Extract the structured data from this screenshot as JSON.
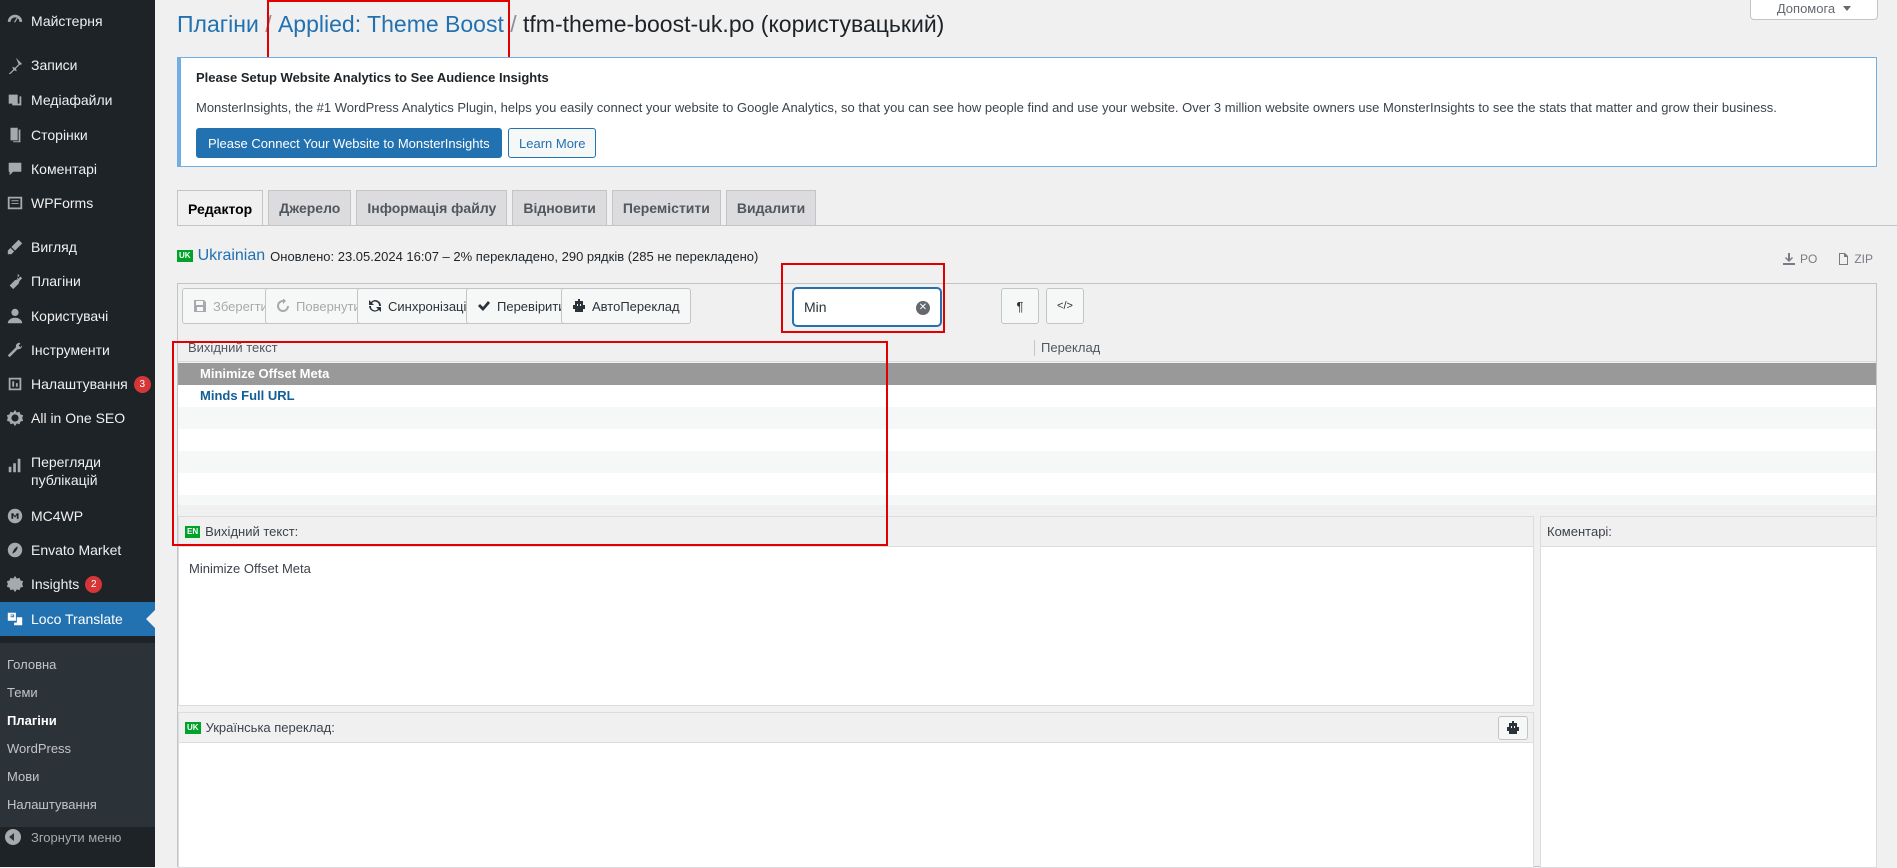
{
  "sidebar": {
    "items": [
      {
        "icon": "dashboard-icon",
        "label": "Майстерня"
      },
      {
        "icon": "pin-icon",
        "label": "Записи"
      },
      {
        "icon": "media-icon",
        "label": "Медіафайли"
      },
      {
        "icon": "page-icon",
        "label": "Сторінки"
      },
      {
        "icon": "comment-icon",
        "label": "Коментарі"
      },
      {
        "icon": "forms-icon",
        "label": "WPForms"
      },
      {
        "icon": "brush-icon",
        "label": "Вигляд"
      },
      {
        "icon": "plugin-icon",
        "label": "Плагіни"
      },
      {
        "icon": "user-icon",
        "label": "Користувачі"
      },
      {
        "icon": "wrench-icon",
        "label": "Інструменти"
      },
      {
        "icon": "settings-icon",
        "label": "Налаштування",
        "badge": "3"
      },
      {
        "icon": "seo-icon",
        "label": "All in One SEO"
      },
      {
        "icon": "chart-icon",
        "label": "Перегляди публікацій"
      },
      {
        "icon": "mail-icon",
        "label": "MC4WP"
      },
      {
        "icon": "leaf-icon",
        "label": "Envato Market"
      },
      {
        "icon": "insights-icon",
        "label": "Insights",
        "badge": "2"
      },
      {
        "icon": "translate-icon",
        "label": "Loco Translate"
      }
    ],
    "submenu": [
      "Головна",
      "Теми",
      "Плагіни",
      "WordPress",
      "Мови",
      "Налаштування"
    ],
    "collapse_label": "Згорнути меню"
  },
  "header": {
    "help_label": "Допомога",
    "crumb_plugins": "Плагіни",
    "crumb_plugin": "Applied: Theme Boost",
    "crumb_file": "tfm-theme-boost-uk.po (користувацький)",
    "sep": "/"
  },
  "notice": {
    "title": "Please Setup Website Analytics to See Audience Insights",
    "text": "MonsterInsights, the #1 WordPress Analytics Plugin, helps you easily connect your website to Google Analytics, so that you can see how people find and use your website. Over 3 million website owners use MonsterInsights to see the stats that matter and grow their business.",
    "primary_button": "Please Connect Your Website to MonsterInsights",
    "secondary_button": "Learn More"
  },
  "tabs": [
    "Редактор",
    "Джерело",
    "Інформація файлу",
    "Відновити",
    "Перемістити",
    "Видалити"
  ],
  "lang": {
    "flag": "UK",
    "name": "Ukrainian",
    "status": "Оновлено: 23.05.2024 16:07 – 2% перекладено, 290 рядків (285 не перекладено)",
    "po": "PO",
    "zip": "ZIP"
  },
  "toolbar": {
    "save": "Зберегти",
    "revert": "Повернути",
    "sync": "Синхронізація",
    "check": "Перевірити",
    "auto": "АвтоПереклад",
    "search_value": "Min",
    "pilcrow": "¶",
    "code": "</>"
  },
  "grid": {
    "col_source": "Вихідний текст",
    "col_translation": "Переклад",
    "rows": [
      "Minimize Offset Meta",
      "Minds Full URL"
    ]
  },
  "source_pane": {
    "flag": "EN",
    "label": "Вихідний текст:",
    "text": "Minimize Offset Meta"
  },
  "comments_pane": {
    "label": "Коментарі:"
  },
  "translation_pane": {
    "flag": "UK",
    "label": "Українська переклад:"
  }
}
